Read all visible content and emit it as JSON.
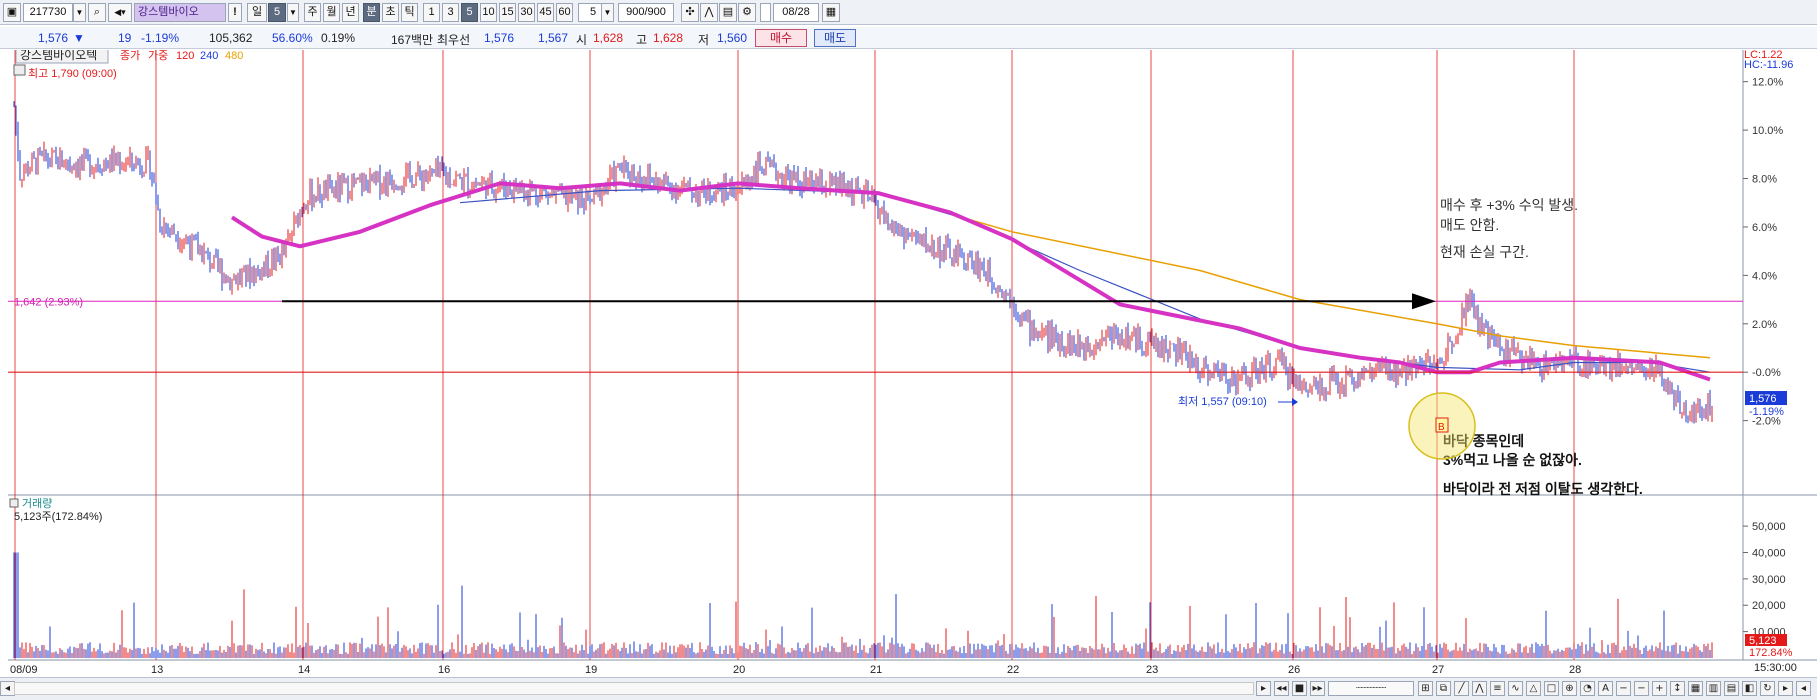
{
  "toolbar": {
    "code": "217730",
    "name": "강스템바이오",
    "bang": "!",
    "day": "일",
    "day_count": "5",
    "periods": [
      "주",
      "월",
      "년",
      "분",
      "초",
      "틱"
    ],
    "selected_period": "분",
    "intervals": [
      "1",
      "3",
      "5",
      "10",
      "15",
      "30",
      "45",
      "60"
    ],
    "selected_interval": "5",
    "count": "5",
    "range": "900/900",
    "date": "08/28"
  },
  "quote": {
    "price": "1,576",
    "arrow": "▼",
    "change": "19",
    "change_pct": "-1.19%",
    "volume": "105,362",
    "vol_ratio": "56.60%",
    "turnover": "0.19%",
    "amount": "167백만",
    "best_label": "최우선",
    "bid1": "1,576",
    "bid2": "1,567",
    "open_label": "시",
    "open": "1,628",
    "high_label": "고",
    "high": "1,628",
    "low_label": "저",
    "low": "1,560",
    "buy_button": "매수",
    "sell_button": "매도"
  },
  "chart_data": {
    "type": "candlestick-intraday",
    "title": "강스템바이오텍",
    "legend": [
      {
        "name": "종가",
        "color": "#e41a1a"
      },
      {
        "name": "가중",
        "color": "#e41a1a"
      },
      {
        "name": "120",
        "color": "#e41a1a"
      },
      {
        "name": "240",
        "color": "#1a3bd8"
      },
      {
        "name": "480",
        "color": "#e8a000"
      }
    ],
    "high_label": "최고 1,790 (09:00)",
    "low_label": "최저 1,557 (09:10)",
    "hline_label": "1,642 (2.93%)",
    "hline_pct": 2.93,
    "lc": "LC:1.22",
    "hc": "HC:-11.96",
    "y_ticks": [
      "12.0%",
      "10.0%",
      "8.0%",
      "6.0%",
      "4.0%",
      "2.0%",
      "-0.0%",
      "-2.0%"
    ],
    "y_values": [
      12,
      10,
      8,
      6,
      4,
      2,
      0,
      -2
    ],
    "ylim": [
      -2.8,
      12.4
    ],
    "x_labels": [
      "08/09",
      "13",
      "14",
      "16",
      "19",
      "20",
      "21",
      "22",
      "23",
      "26",
      "27",
      "28"
    ],
    "last_price_tag": "1,576",
    "last_pct_tag": "-1.19%",
    "annotation_1": [
      "매수 후 +3% 수익 발생.",
      "매도 안함.",
      "",
      "현재 손실 구간."
    ],
    "annotation_2": [
      "바닥 종목인데",
      "3%먹고 나올 순 없잖아.",
      "",
      "바닥이라 전 저점 이탈도 생각한다."
    ],
    "buy_marker": "B",
    "volume_title": "거래량",
    "volume_value": "5,123주(172.84%)",
    "volume_ticks": [
      "50,000",
      "40,000",
      "30,000",
      "20,000",
      "10,000"
    ],
    "volume_tick_values": [
      50000,
      40000,
      30000,
      20000,
      10000
    ],
    "volume_tag": "5,123",
    "volume_pct_tag": "172.84%",
    "time_label": "15:30:00",
    "colors": {
      "up": "#e41a1a",
      "down": "#1a3bd8",
      "ma_magenta": "#d633c4",
      "ma_blue": "#3a52c4",
      "ma_orange": "#e8a000"
    }
  }
}
